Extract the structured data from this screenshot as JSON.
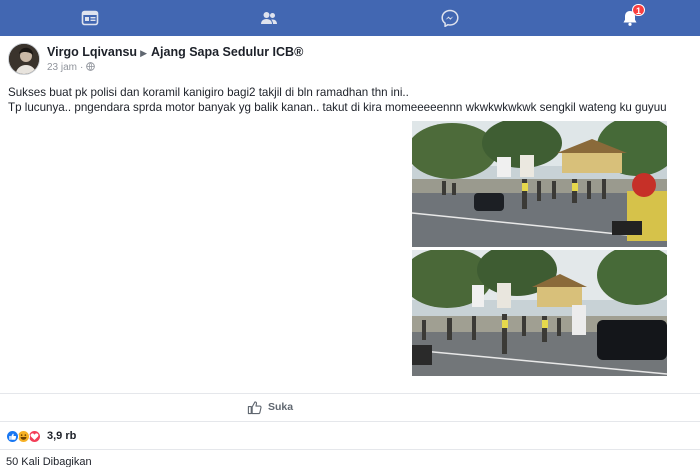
{
  "topbar": {
    "color": "#4267b2",
    "icons": [
      {
        "name": "feed-icon"
      },
      {
        "name": "friends-icon"
      },
      {
        "name": "messenger-icon"
      },
      {
        "name": "notifications-icon"
      }
    ],
    "notification_badge": "1"
  },
  "post": {
    "author": "Virgo Lqivansu",
    "group": "Ajang Sapa Sedulur ICB®",
    "timestamp": "23 jam",
    "privacy_icon": "globe-icon",
    "text_lines": [
      "Sukses buat pk polisi dan koramil kanigiro bagi2 takjil di bln ramadhan thn ini..",
      "Tp lucunya.. pngendara sprda motor banyak yg balik kanan.. takut di kira momeeeeennn wkwkwkwkwk sengkil wateng ku guyuu"
    ],
    "photos": [
      {
        "name": "photo-1"
      },
      {
        "name": "photo-2"
      }
    ]
  },
  "actions": {
    "like_label": "Suka"
  },
  "reactions": {
    "icons": [
      "like-reaction-icon",
      "haha-reaction-icon",
      "love-reaction-icon"
    ],
    "count": "3,9 rb"
  },
  "shares": {
    "label": "50 Kali Dibagikan"
  }
}
